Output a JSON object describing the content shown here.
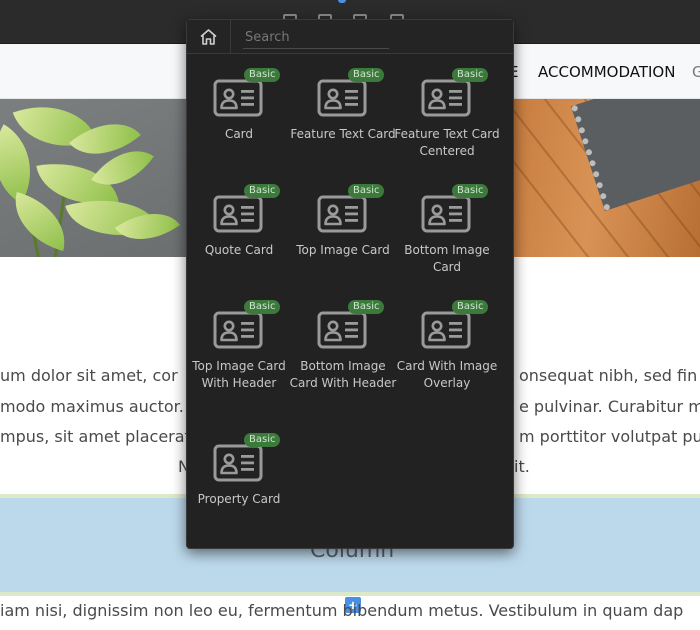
{
  "site_nav": {
    "items": [
      "E",
      "ACCOMMODATION",
      "G"
    ]
  },
  "page_text": {
    "lines": [
      {
        "left": "um dolor sit amet, cor",
        "right": "onsequat nibh, sed fin"
      },
      {
        "left": "modo maximus auctor.",
        "right": "e pulvinar. Curabitur m"
      },
      {
        "left": "mpus, sit amet placerat",
        "right": "m porttitor volutpat pu"
      },
      {
        "left": "N",
        "right": "it."
      }
    ],
    "column_label": "Column",
    "bottom_line": "iam nisi, dignissim non leo eu, fermentum bibendum metus. Vestibulum in quam dap"
  },
  "add_button": "+",
  "picker": {
    "search": {
      "placeholder": "Search",
      "value": ""
    },
    "items": [
      {
        "label": "Card",
        "badge": "Basic"
      },
      {
        "label": "Feature Text Card",
        "badge": "Basic"
      },
      {
        "label": "Feature Text Card Centered",
        "badge": "Basic"
      },
      {
        "label": "Quote Card",
        "badge": "Basic"
      },
      {
        "label": "Top Image Card",
        "badge": "Basic"
      },
      {
        "label": "Bottom Image Card",
        "badge": "Basic"
      },
      {
        "label": "Top Image Card With Header",
        "badge": "Basic"
      },
      {
        "label": "Bottom Image Card With Header",
        "badge": "Basic"
      },
      {
        "label": "Card With Image Overlay",
        "badge": "Basic"
      },
      {
        "label": "Property Card",
        "badge": "Basic"
      }
    ]
  },
  "colors": {
    "picker_bg": "#222222",
    "badge_bg": "#3c7a3c",
    "column_band": "#bcd9ec",
    "accent": "#4a90e2"
  },
  "icons": {
    "home": "home-icon",
    "card": "id-card-icon"
  }
}
